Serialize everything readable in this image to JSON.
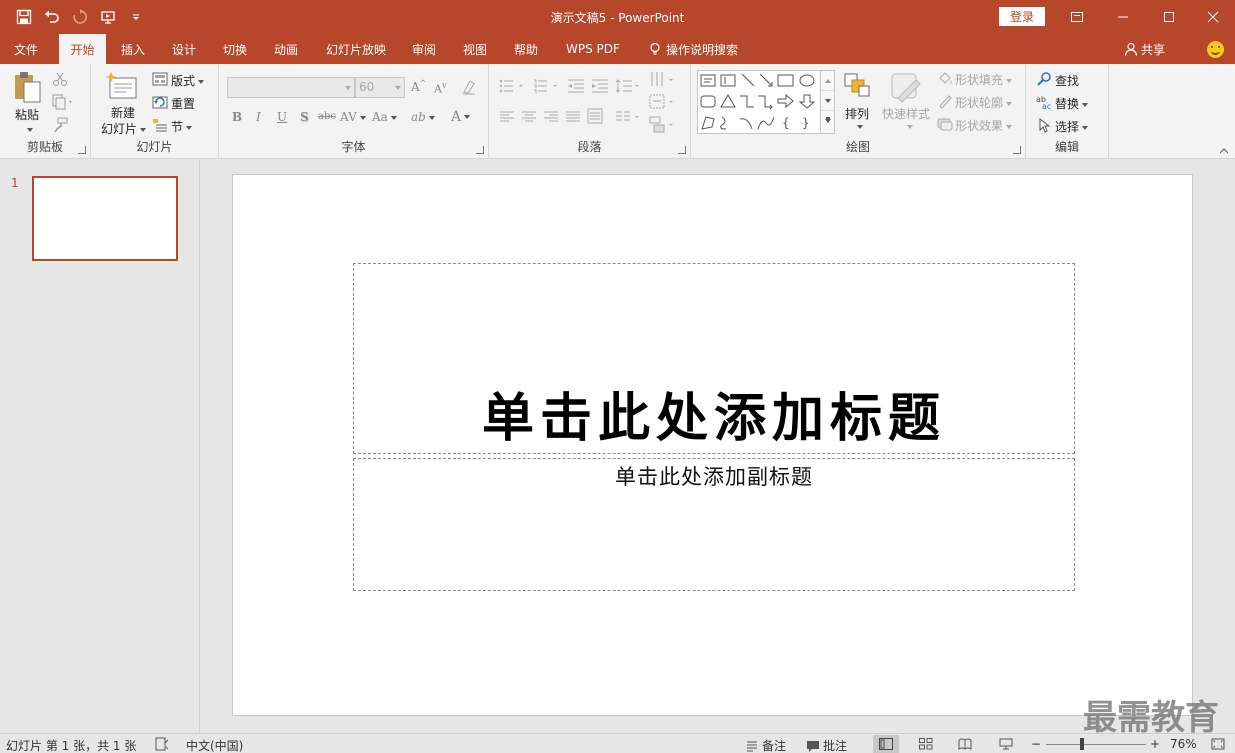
{
  "titlebar": {
    "doc_name": "演示文稿5",
    "separator": "-",
    "app_name": "PowerPoint",
    "login_label": "登录"
  },
  "tabs": [
    {
      "label": "文件"
    },
    {
      "label": "开始"
    },
    {
      "label": "插入"
    },
    {
      "label": "设计"
    },
    {
      "label": "切换"
    },
    {
      "label": "动画"
    },
    {
      "label": "幻灯片放映"
    },
    {
      "label": "审阅"
    },
    {
      "label": "视图"
    },
    {
      "label": "帮助"
    },
    {
      "label": "WPS PDF"
    },
    {
      "label": "操作说明搜索"
    }
  ],
  "share_label": "共享",
  "ribbon": {
    "clipboard": {
      "group": "剪贴板",
      "paste": "粘贴"
    },
    "slides": {
      "group": "幻灯片",
      "new_slide_1": "新建",
      "new_slide_2": "幻灯片",
      "layout": "版式",
      "reset": "重置",
      "section": "节"
    },
    "font": {
      "group": "字体",
      "font_size": "60",
      "bold": "B",
      "italic": "I",
      "underline": "U",
      "shadow": "S",
      "strike": "abc",
      "spacing": "AV",
      "case": "Aa",
      "color": "A",
      "grow": "A",
      "shrink": "A"
    },
    "paragraph": {
      "group": "段落"
    },
    "drawing": {
      "group": "绘图",
      "arrange": "排列",
      "quick_styles": "快速样式",
      "shape_fill": "形状填充",
      "shape_outline": "形状轮廓",
      "shape_effects": "形状效果"
    },
    "editing": {
      "group": "编辑",
      "find": "查找",
      "replace": "替换",
      "select": "选择"
    }
  },
  "thumbnails": [
    {
      "number": "1"
    }
  ],
  "slide": {
    "title_placeholder": "单击此处添加标题",
    "subtitle_placeholder": "单击此处添加副标题"
  },
  "status": {
    "slide_info": "幻灯片 第 1 张，共 1 张",
    "language": "中文(中国)",
    "notes": "备注",
    "comments": "批注",
    "zoom_minus": "−",
    "zoom_plus": "+",
    "zoom": "76%"
  },
  "watermark": "最需教育",
  "colors": {
    "accent": "#b7472a",
    "ribbon_bg": "#f3f3f3",
    "workspace_bg": "#e6e6e6"
  }
}
